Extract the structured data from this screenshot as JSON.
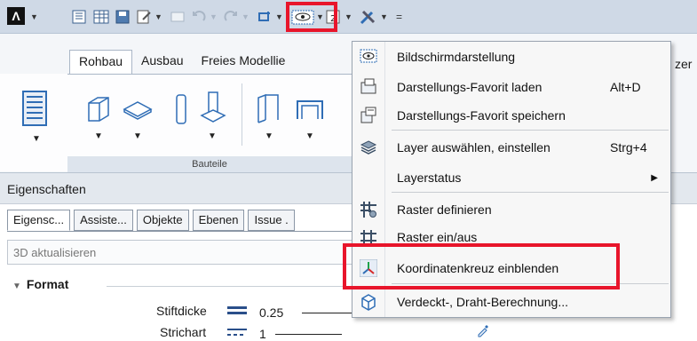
{
  "app": {
    "logo_glyph": "Λ"
  },
  "ribbon": {
    "tabs": [
      "Rohbau",
      "Ausbau",
      "Freies Modellie"
    ],
    "right_tab_fragment": "zer",
    "group_label": "Bauteile"
  },
  "properties": {
    "title": "Eigenschaften",
    "tabs": [
      "Eigensc...",
      "Assiste...",
      "Objekte",
      "Ebenen",
      "Issue ."
    ],
    "refresh_label": "3D aktualisieren",
    "section": "Format",
    "rows": [
      {
        "label": "Stiftdicke",
        "value": "0.25"
      },
      {
        "label": "Strichart",
        "value": "1"
      }
    ]
  },
  "menu": {
    "items": [
      {
        "label": "Bildschirmdarstellung",
        "shortcut": "",
        "icon": "eye-icon"
      },
      {
        "label": "Darstellungs-Favorit laden",
        "shortcut": "Alt+D",
        "icon": "folder-open-icon"
      },
      {
        "label": "Darstellungs-Favorit speichern",
        "shortcut": "",
        "icon": "save-favorite-icon"
      },
      {
        "label": "Layer auswählen, einstellen",
        "shortcut": "Strg+4",
        "icon": "layers-icon"
      },
      {
        "label": "Layerstatus",
        "shortcut": "",
        "icon": "",
        "submenu": true
      },
      {
        "label": "Raster definieren",
        "shortcut": "",
        "icon": "grid-settings-icon"
      },
      {
        "label": "Raster ein/aus",
        "shortcut": "",
        "icon": "grid-toggle-icon"
      },
      {
        "label": "Koordinatenkreuz einblenden",
        "shortcut": "",
        "icon": "coordinate-cross-icon"
      },
      {
        "label": "Verdeckt-, Draht-Berechnung...",
        "shortcut": "",
        "icon": "hidden-line-icon"
      }
    ]
  },
  "colors": {
    "highlight": "#e8152b",
    "toolbar_bg": "#cfd9e6",
    "accent_blue": "#2f6db5"
  }
}
